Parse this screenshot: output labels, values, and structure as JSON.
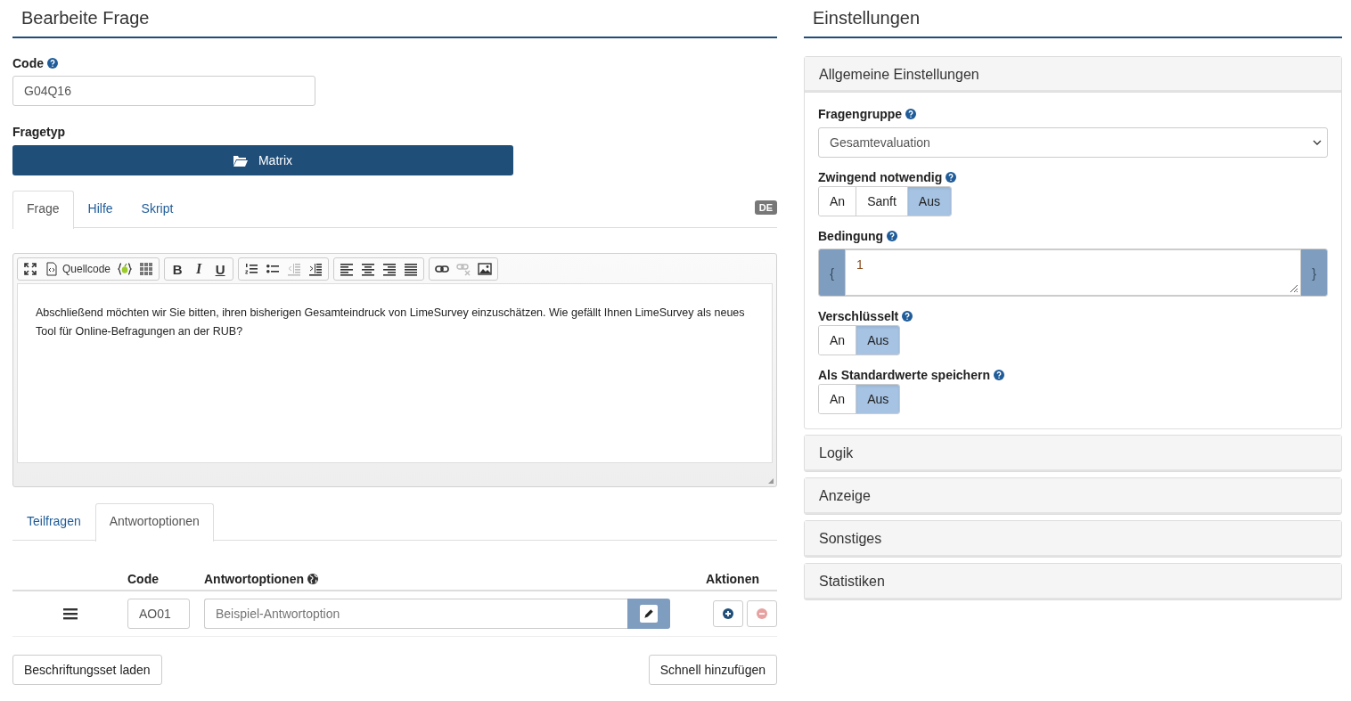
{
  "editor": {
    "title": "Bearbeite Frage",
    "code": {
      "label": "Code",
      "help": true,
      "value": "G04Q16"
    },
    "question_type": {
      "label": "Fragetyp",
      "value": "Matrix"
    },
    "text_tabs": [
      {
        "label": "Frage",
        "selected": true
      },
      {
        "label": "Hilfe",
        "selected": false
      },
      {
        "label": "Skript",
        "selected": false
      }
    ],
    "language_badge": "DE",
    "toolbar": [
      [
        {
          "kind": "maximize",
          "disabled": false
        },
        {
          "kind": "source",
          "label": "Quellcode",
          "disabled": false
        },
        {
          "kind": "expression",
          "disabled": false
        },
        {
          "kind": "table",
          "disabled": false
        }
      ],
      [
        {
          "kind": "bold",
          "label": "B",
          "disabled": false
        },
        {
          "kind": "italic",
          "label": "I",
          "disabled": false
        },
        {
          "kind": "underline",
          "label": "U",
          "disabled": false
        }
      ],
      [
        {
          "kind": "numbered-list",
          "disabled": false
        },
        {
          "kind": "bullet-list",
          "disabled": false
        },
        {
          "kind": "outdent",
          "disabled": true
        },
        {
          "kind": "indent",
          "disabled": false
        }
      ],
      [
        {
          "kind": "align-left",
          "disabled": false
        },
        {
          "kind": "align-center",
          "disabled": false
        },
        {
          "kind": "align-right",
          "disabled": false
        },
        {
          "kind": "justify",
          "disabled": false
        }
      ],
      [
        {
          "kind": "link",
          "disabled": false
        },
        {
          "kind": "unlink",
          "disabled": true
        },
        {
          "kind": "image",
          "disabled": false
        }
      ]
    ],
    "text": "Abschließend möchten wir Sie bitten, ihren bisherigen Gesamteindruck von LimeSurvey einzuschätzen. Wie gefällt Ihnen LimeSurvey als neues Tool für Online-Befragungen an der RUB?",
    "answer_tabs": [
      {
        "label": "Teilfragen",
        "selected": false
      },
      {
        "label": "Antwortoptionen",
        "selected": true
      }
    ],
    "table": {
      "columns": [
        {
          "label": "Code",
          "translatable": false
        },
        {
          "label": "Antwortoptionen",
          "translatable": true
        },
        {
          "label": "Aktionen",
          "translatable": false
        }
      ],
      "rows": [
        {
          "code": "AO01",
          "placeholder": "Beispiel-Antwortoption",
          "delete_disabled": true
        }
      ]
    },
    "buttons": [
      "Beschriftungsset laden",
      "Schnell hinzufügen"
    ]
  },
  "settings": {
    "title": "Einstellungen",
    "sections": [
      {
        "title": "Allgemeine Einstellungen",
        "expanded": true,
        "fields": [
          {
            "kind": "select",
            "label": "Fragengruppe",
            "help": true,
            "value": "Gesamtevaluation"
          },
          {
            "kind": "toggle",
            "label": "Zwingend notwendig",
            "help": true,
            "options": [
              {
                "label": "An",
                "selected": false
              },
              {
                "label": "Sanft",
                "selected": false
              },
              {
                "label": "Aus",
                "selected": true
              }
            ]
          },
          {
            "kind": "expression",
            "label": "Bedingung",
            "help": true,
            "open": "{",
            "value": "1",
            "close": "}"
          },
          {
            "kind": "toggle",
            "label": "Verschlüsselt",
            "help": true,
            "options": [
              {
                "label": "An",
                "selected": false
              },
              {
                "label": "Aus",
                "selected": true
              }
            ]
          },
          {
            "kind": "toggle",
            "label": "Als Standardwerte speichern",
            "help": true,
            "options": [
              {
                "label": "An",
                "selected": false
              },
              {
                "label": "Aus",
                "selected": true
              }
            ]
          }
        ]
      },
      {
        "title": "Logik",
        "expanded": false
      },
      {
        "title": "Anzeige",
        "expanded": false
      },
      {
        "title": "Sonstiges",
        "expanded": false
      },
      {
        "title": "Statistiken",
        "expanded": false
      }
    ]
  }
}
